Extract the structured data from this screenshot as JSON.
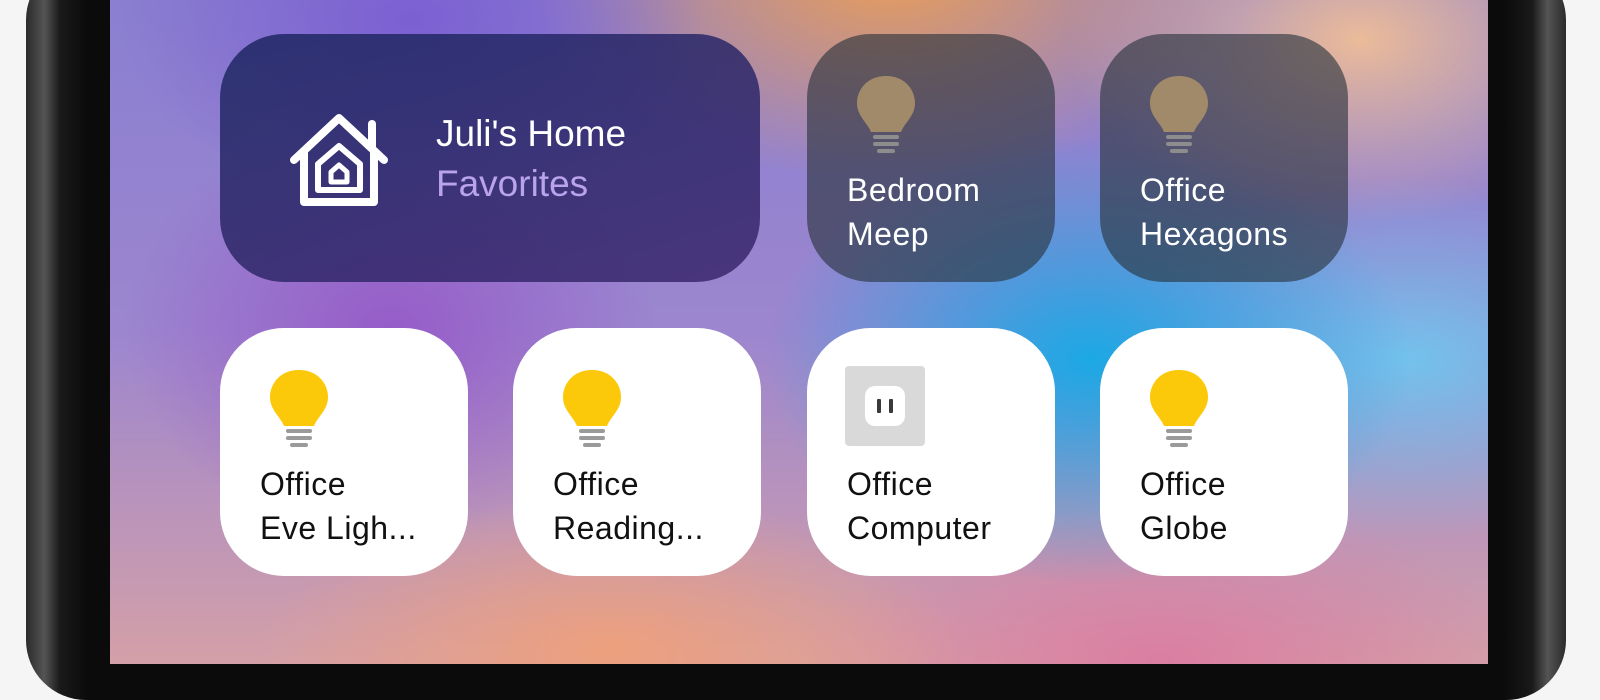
{
  "home": {
    "title": "Juli's Home",
    "subtitle": "Favorites",
    "subtitle_color": "#b9a3ee",
    "icon": "home-icon"
  },
  "accessories": [
    {
      "line1": "Bedroom",
      "line2": "Meep",
      "icon": "lightbulb-icon",
      "state": "off"
    },
    {
      "line1": "Office",
      "line2": "Hexagons",
      "icon": "lightbulb-icon",
      "state": "off"
    },
    {
      "line1": "Office",
      "line2": "Eve Ligh...",
      "icon": "lightbulb-icon",
      "state": "on"
    },
    {
      "line1": "Office",
      "line2": "Reading...",
      "icon": "lightbulb-icon",
      "state": "on"
    },
    {
      "line1": "Office",
      "line2": "Computer",
      "icon": "outlet-icon",
      "state": "off"
    },
    {
      "line1": "Office",
      "line2": "Globe",
      "icon": "lightbulb-icon",
      "state": "on"
    }
  ],
  "colors": {
    "bulb_on": "#fbc80a",
    "bulb_off": "#a08a6a",
    "tile_on_bg": "#ffffff",
    "tile_off_bg": "rgba(40,50,60,0.62)"
  }
}
